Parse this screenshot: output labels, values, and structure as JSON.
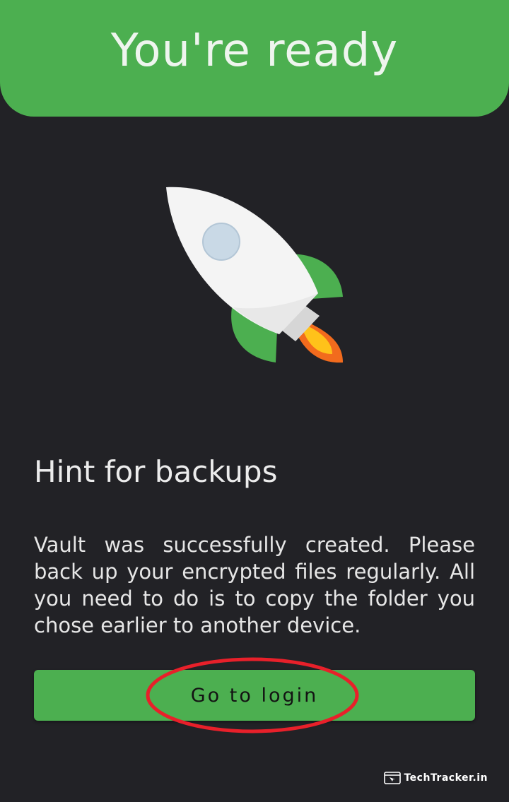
{
  "header": {
    "title": "You're ready",
    "background_color": "#4caf50"
  },
  "illustration": {
    "icon": "rocket-icon"
  },
  "hint": {
    "title": "Hint for backups",
    "body": "Vault was successfully created. Please back up your encrypted files regularly. All you need to do is to copy the folder you chose earlier to another device."
  },
  "actions": {
    "login_label": "Go to login",
    "button_color": "#4caf50"
  },
  "annotation": {
    "icon": "red-ellipse-highlight",
    "color": "#e8202a"
  },
  "watermark": {
    "icon": "browser-window-icon",
    "text": "TechTracker.in"
  }
}
